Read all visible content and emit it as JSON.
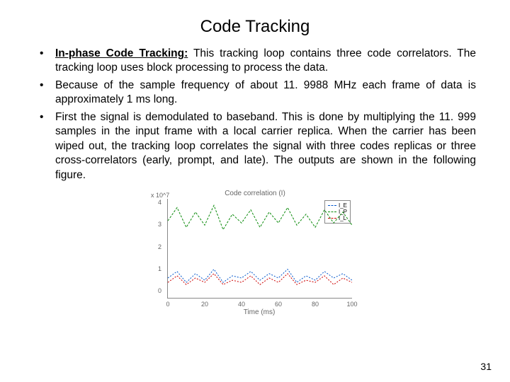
{
  "title": "Code Tracking",
  "bullets": [
    {
      "bold": "In-phase Code Tracking:",
      "text": " This tracking loop contains three code correlators. The tracking loop uses block processing to process the data."
    },
    {
      "bold": "",
      "text": "Because of the sample frequency of about 11. 9988 MHz each frame of data is approximately 1 ms long."
    },
    {
      "bold": "",
      "text": "First the signal is demodulated to baseband. This is done by multiplying the 11. 999 samples in the input frame with a local carrier replica. When the carrier has been wiped out, the tracking loop correlates the signal with three codes replicas or three cross-correlators  (early, prompt, and late). The outputs are shown in the following figure."
    }
  ],
  "page_number": "31",
  "chart_data": {
    "type": "line",
    "title": "Code correlation (I)",
    "xlabel": "Time (ms)",
    "ylabel": "",
    "y_exponent": "x 10^7",
    "xlim": [
      0,
      100
    ],
    "ylim": [
      0,
      4.5
    ],
    "xticks": [
      "0",
      "20",
      "40",
      "60",
      "80",
      "100"
    ],
    "yticks": [
      "0",
      "1",
      "2",
      "3",
      "4"
    ],
    "legend": [
      "I_E",
      "I_P",
      "I_L"
    ],
    "colors": {
      "I_E": "#0055cc",
      "I_P": "#0a8a0a",
      "I_L": "#cc0000"
    },
    "x": [
      0,
      5,
      10,
      15,
      20,
      25,
      30,
      35,
      40,
      45,
      50,
      55,
      60,
      65,
      70,
      75,
      80,
      85,
      90,
      95,
      100
    ],
    "series": [
      {
        "name": "I_P",
        "values": [
          3.5,
          4.1,
          3.2,
          3.9,
          3.3,
          4.2,
          3.1,
          3.8,
          3.4,
          4.0,
          3.2,
          3.9,
          3.4,
          4.1,
          3.3,
          3.8,
          3.2,
          4.0,
          3.4,
          3.9,
          3.3
        ]
      },
      {
        "name": "I_E",
        "values": [
          0.9,
          1.2,
          0.7,
          1.1,
          0.8,
          1.3,
          0.7,
          1.0,
          0.9,
          1.2,
          0.8,
          1.1,
          0.9,
          1.3,
          0.7,
          1.0,
          0.8,
          1.2,
          0.9,
          1.1,
          0.8
        ]
      },
      {
        "name": "I_L",
        "values": [
          0.7,
          1.0,
          0.6,
          0.9,
          0.7,
          1.1,
          0.6,
          0.8,
          0.7,
          1.0,
          0.6,
          0.9,
          0.7,
          1.1,
          0.6,
          0.8,
          0.7,
          1.0,
          0.6,
          0.9,
          0.7
        ]
      }
    ]
  }
}
